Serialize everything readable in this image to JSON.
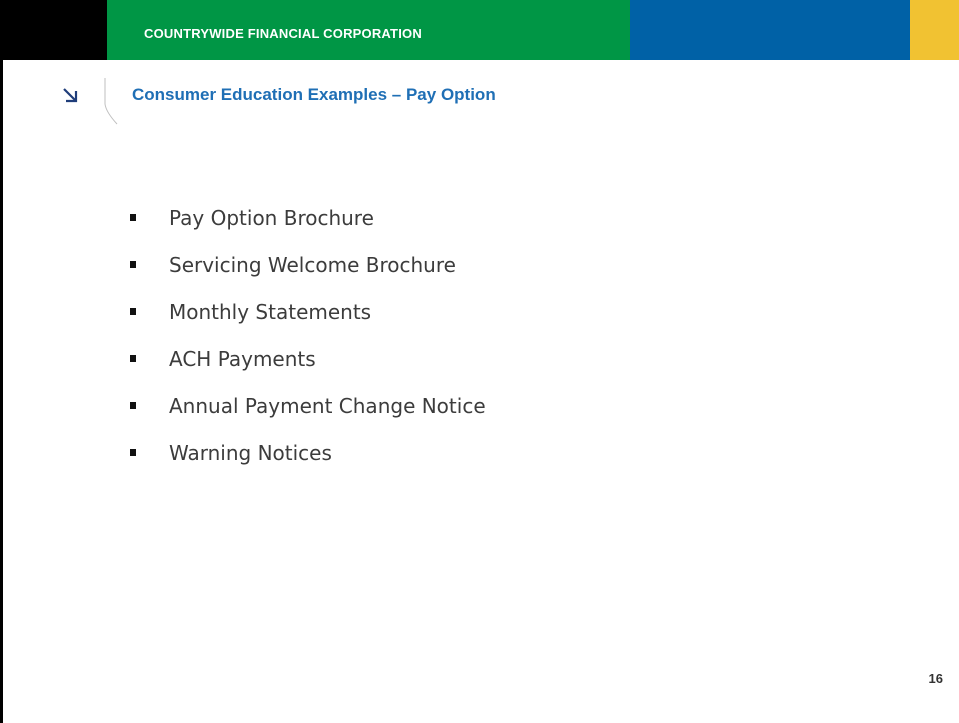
{
  "header": {
    "company": "COUNTRYWIDE FINANCIAL CORPORATION",
    "colors": {
      "black": "#000000",
      "green": "#009645",
      "blue": "#0061a6",
      "yellow": "#f1c232"
    }
  },
  "slide": {
    "title_icon": "arrow-down-right-icon",
    "title": "Consumer Education Examples – Pay Option",
    "title_color": "#1f6fb5",
    "bullets": [
      {
        "label": "Pay Option Brochure"
      },
      {
        "label": "Servicing Welcome Brochure"
      },
      {
        "label": "Monthly Statements"
      },
      {
        "label": "ACH Payments"
      },
      {
        "label": "Annual Payment Change Notice"
      },
      {
        "label": "Warning Notices"
      }
    ],
    "page_number": "16"
  }
}
